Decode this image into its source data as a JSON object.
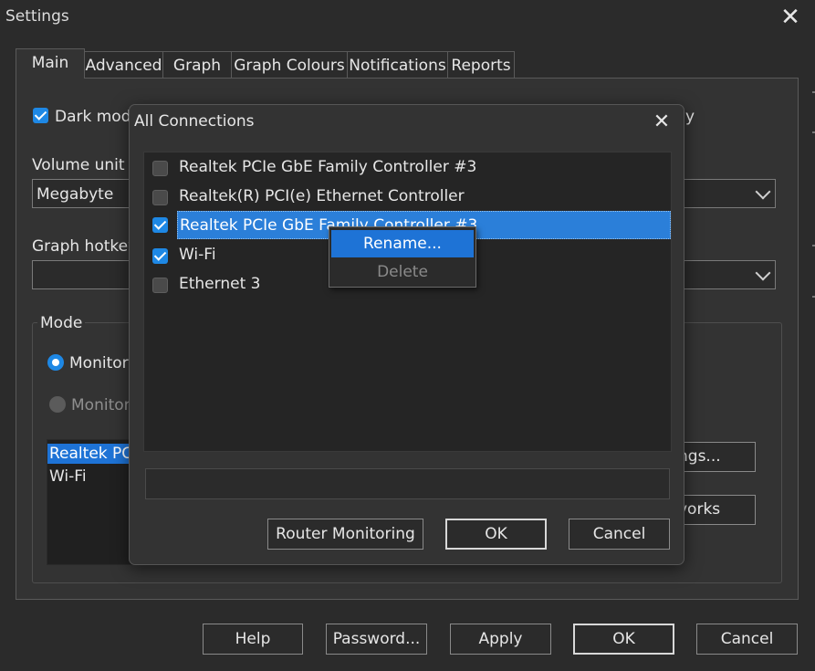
{
  "window": {
    "title": "Settings",
    "close_glyph": "✕"
  },
  "tabs": [
    {
      "label": "Main"
    },
    {
      "label": "Advanced"
    },
    {
      "label": "Graph"
    },
    {
      "label": "Graph Colours"
    },
    {
      "label": "Notifications"
    },
    {
      "label": "Reports"
    }
  ],
  "main": {
    "dark_mode_label": "Dark mod",
    "right_checkbox_partial": "y",
    "volume_unit_label": "Volume unit",
    "volume_unit_value": "Megabyte",
    "graph_hotkey_label": "Graph hotkey",
    "graph_hotkey_value": "",
    "mode_group_label": "Mode",
    "mode_options": [
      {
        "label": "Monitor",
        "selected": true
      },
      {
        "label": "Monitor",
        "selected": false
      }
    ],
    "interfaces_list": [
      {
        "label": "Realtek PCI",
        "selected": true
      },
      {
        "label": "Wi-Fi",
        "selected": false
      }
    ],
    "side_button_1": "ngs...",
    "side_button_2": "vorks"
  },
  "footer": {
    "help": "Help",
    "password": "Password...",
    "apply": "Apply",
    "ok": "OK",
    "cancel": "Cancel"
  },
  "dialog": {
    "title": "All Connections",
    "close_glyph": "✕",
    "connections": [
      {
        "name": "Realtek PCIe GbE Family Controller #3",
        "checked": false
      },
      {
        "name": "Realtek(R) PCI(e) Ethernet Controller",
        "checked": false
      },
      {
        "name": "Realtek PCIe GbE Family Controller #3",
        "checked": true
      },
      {
        "name": "Wi-Fi",
        "checked": true
      },
      {
        "name": "Ethernet 3",
        "checked": false
      }
    ],
    "status_value": "",
    "router_button": "Router Monitoring",
    "ok_button": "OK",
    "cancel_button": "Cancel"
  },
  "context_menu": {
    "rename": "Rename...",
    "delete": "Delete"
  },
  "colors": {
    "accent": "#1e88e5",
    "selection": "#1e73d6",
    "background": "#2b2b2b"
  }
}
